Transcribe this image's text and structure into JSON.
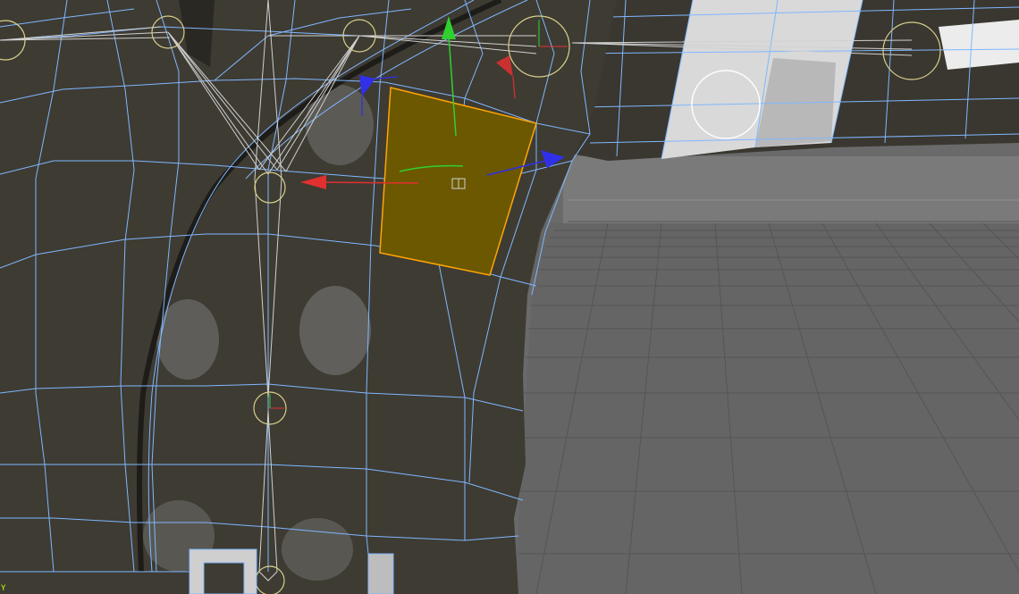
{
  "viewport": {
    "axis_indicator_label": "Y"
  },
  "colors": {
    "background_gray": "#6a6a6a",
    "grid_floor": "#5e5e5e",
    "grid_line": "#4e4e4e",
    "mesh_fill": "#3e3b33",
    "wireframe": "#7fb7ff",
    "selected_face": "#6b5800",
    "selected_face_edge": "#ffa500",
    "gizmo_x": "#e03030",
    "gizmo_y": "#30d030",
    "gizmo_z": "#3030e8",
    "joint": "#d6cf8a",
    "bone": "#d0d0d0",
    "limb_light": "#e2e2e2",
    "axis_label": "#c8ff00"
  },
  "icons": {
    "move_gizmo": "transform-move-gizmo-icon",
    "brush_cursor": "brush-circle-cursor-icon",
    "pivot": "pivot-cube-icon"
  }
}
